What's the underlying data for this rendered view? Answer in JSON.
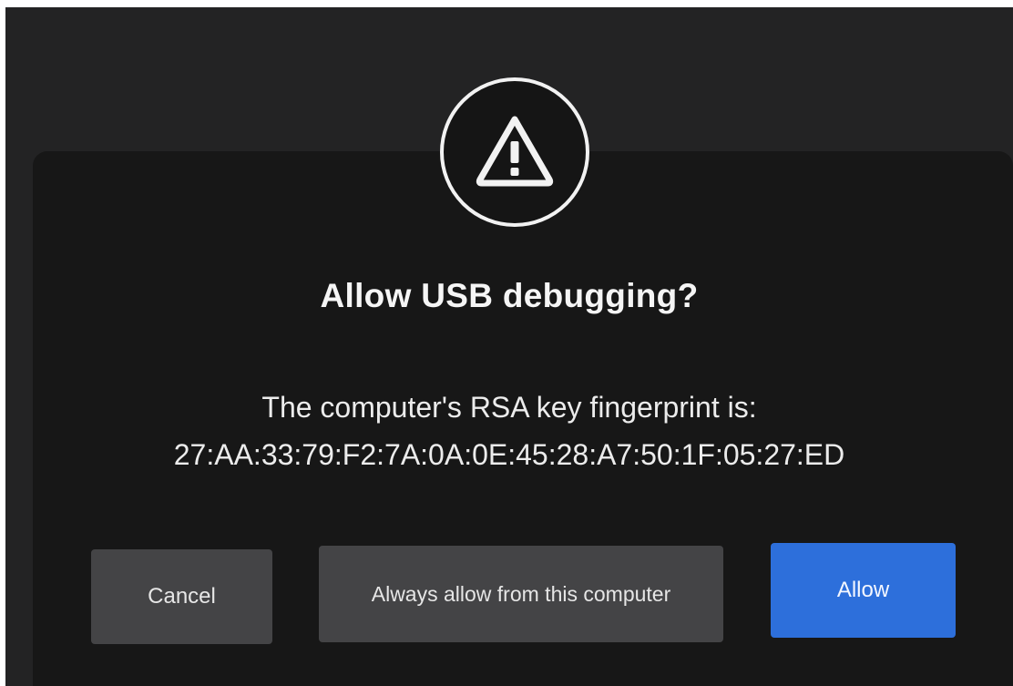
{
  "dialog": {
    "title": "Allow USB debugging?",
    "message_line1": "The computer's RSA key fingerprint is:",
    "fingerprint": "27:AA:33:79:F2:7A:0A:0E:45:28:A7:50:1F:05:27:ED",
    "icon": "warning-triangle-icon"
  },
  "buttons": {
    "cancel_label": "Cancel",
    "always_label": "Always allow from this computer",
    "allow_label": "Allow"
  },
  "colors": {
    "background": "#232324",
    "dialog": "#171717",
    "secondary_button": "#444446",
    "primary_button": "#2d6fdb"
  }
}
